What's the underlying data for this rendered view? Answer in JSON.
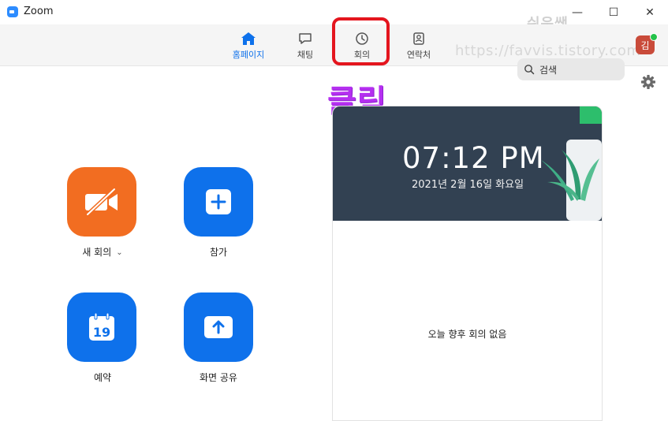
{
  "window": {
    "title": "Zoom",
    "controls": {
      "minimize": "—",
      "maximize": "☐",
      "close": "✕"
    }
  },
  "nav": {
    "tabs": [
      {
        "label": "홈페이지",
        "icon": "home-icon",
        "active": true
      },
      {
        "label": "채팅",
        "icon": "chat-icon",
        "active": false
      },
      {
        "label": "회의",
        "icon": "clock-icon",
        "active": false
      },
      {
        "label": "연락처",
        "icon": "contacts-icon",
        "active": false
      }
    ]
  },
  "search": {
    "label": "검색"
  },
  "user": {
    "avatar_initial": "김",
    "status": "online"
  },
  "watermark": {
    "title": "쉬운쌤",
    "url": "https://favvis.tistory.com"
  },
  "annotation": {
    "text": "클릭"
  },
  "actions": {
    "new_meeting": {
      "label": "새 회의",
      "color": "#f26d21"
    },
    "join": {
      "label": "참가",
      "color": "#0e71eb"
    },
    "schedule": {
      "label": "예약",
      "calendar_day": "19",
      "color": "#0e71eb"
    },
    "share_screen": {
      "label": "화면 공유",
      "color": "#0e71eb"
    }
  },
  "panel": {
    "time": "07:12 PM",
    "date": "2021년 2월 16일 화요일",
    "empty_message": "오늘 향후 회의 없음"
  },
  "colors": {
    "accent": "#0e71eb",
    "orange": "#f26d21",
    "highlight": "#e4151e",
    "annotation": "#b52ff0",
    "banner": "#324152"
  }
}
